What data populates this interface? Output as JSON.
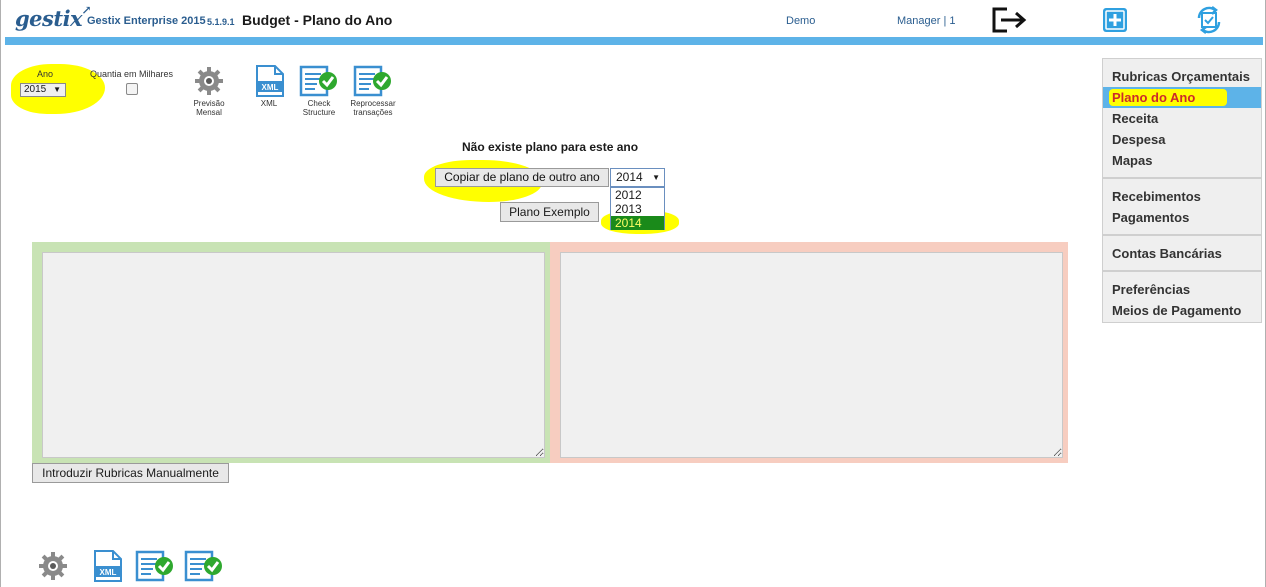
{
  "header": {
    "logo": "gestix",
    "app_name": "Gestix Enterprise 2015",
    "version": "5.1.9.1",
    "title": "Budget - Plano do Ano",
    "demo": "Demo",
    "user": "Manager | 1",
    "icons": {
      "logout": "logout-icon",
      "add": "add-icon",
      "sync": "sync-icon"
    }
  },
  "toolbar": {
    "ano_label": "Ano",
    "ano_value": "2015",
    "milhares_label": "Quantia em Milhares",
    "milhares_checked": false,
    "tools": [
      {
        "name": "previsao-mensal",
        "icon": "gear-icon",
        "label_line1": "Previsão",
        "label_line2": "Mensal"
      },
      {
        "name": "xml",
        "icon": "xml-document-icon",
        "label_line1": "XML",
        "label_line2": ""
      },
      {
        "name": "check-structure",
        "icon": "document-check-icon",
        "label_line1": "Check",
        "label_line2": "Structure"
      },
      {
        "name": "reprocessar-transacoes",
        "icon": "document-check-icon",
        "label_line1": "Reprocessar",
        "label_line2": "transações"
      }
    ]
  },
  "main": {
    "no_plan_message": "Não existe plano para este ano",
    "copy_button": "Copiar de plano de outro ano",
    "year_select_value": "2014",
    "year_options": [
      "2012",
      "2013",
      "2014"
    ],
    "year_selected_index": 2,
    "plano_exemplo_button": "Plano Exemplo",
    "manual_button": "Introduzir Rubricas Manualmente"
  },
  "menu": {
    "groups": [
      [
        "Rubricas Orçamentais",
        "Plano do Ano",
        "Receita",
        "Despesa",
        "Mapas"
      ],
      [
        "Recebimentos",
        "Pagamentos"
      ],
      [
        "Contas Bancárias"
      ],
      [
        "Preferências",
        "Meios de Pagamento"
      ]
    ],
    "active": "Plano do Ano"
  },
  "colors": {
    "brand_blue": "#2a5d8f",
    "accent_bar": "#5db3e8",
    "highlight": "#ffff00",
    "green_panel": "#c8e3b4",
    "pink_panel": "#f7cdc0",
    "selected_option": "#1a8a1a"
  }
}
